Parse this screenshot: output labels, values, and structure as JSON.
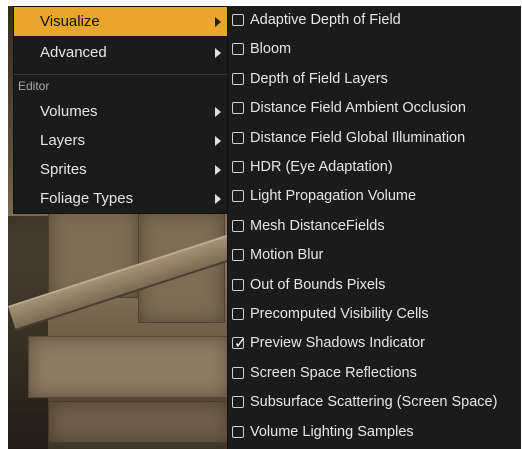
{
  "menu": {
    "items": [
      {
        "label": "Visualize",
        "active": true,
        "has_submenu": true
      },
      {
        "label": "Advanced",
        "active": false,
        "has_submenu": true
      }
    ],
    "section_label": "Editor",
    "editor_items": [
      {
        "label": "Volumes",
        "has_submenu": true
      },
      {
        "label": "Layers",
        "has_submenu": true
      },
      {
        "label": "Sprites",
        "has_submenu": true
      },
      {
        "label": "Foliage Types",
        "has_submenu": true
      }
    ],
    "accent_color": "#e8a72a",
    "background_color": "#1b1b1b"
  },
  "submenu": {
    "items": [
      {
        "label": "Adaptive Depth of Field",
        "checked": false
      },
      {
        "label": "Bloom",
        "checked": false
      },
      {
        "label": "Depth of Field Layers",
        "checked": false
      },
      {
        "label": "Distance Field Ambient Occlusion",
        "checked": false
      },
      {
        "label": "Distance Field Global Illumination",
        "checked": false
      },
      {
        "label": "HDR (Eye Adaptation)",
        "checked": false
      },
      {
        "label": "Light Propagation Volume",
        "checked": false
      },
      {
        "label": "Mesh DistanceFields",
        "checked": false
      },
      {
        "label": "Motion Blur",
        "checked": false
      },
      {
        "label": "Out of Bounds Pixels",
        "checked": false
      },
      {
        "label": "Precomputed Visibility Cells",
        "checked": false
      },
      {
        "label": "Preview Shadows Indicator",
        "checked": true
      },
      {
        "label": "Screen Space Reflections",
        "checked": false
      },
      {
        "label": "Subsurface Scattering (Screen Space)",
        "checked": false
      },
      {
        "label": "Volume Lighting Samples",
        "checked": false
      }
    ],
    "check_mark": "✓"
  }
}
